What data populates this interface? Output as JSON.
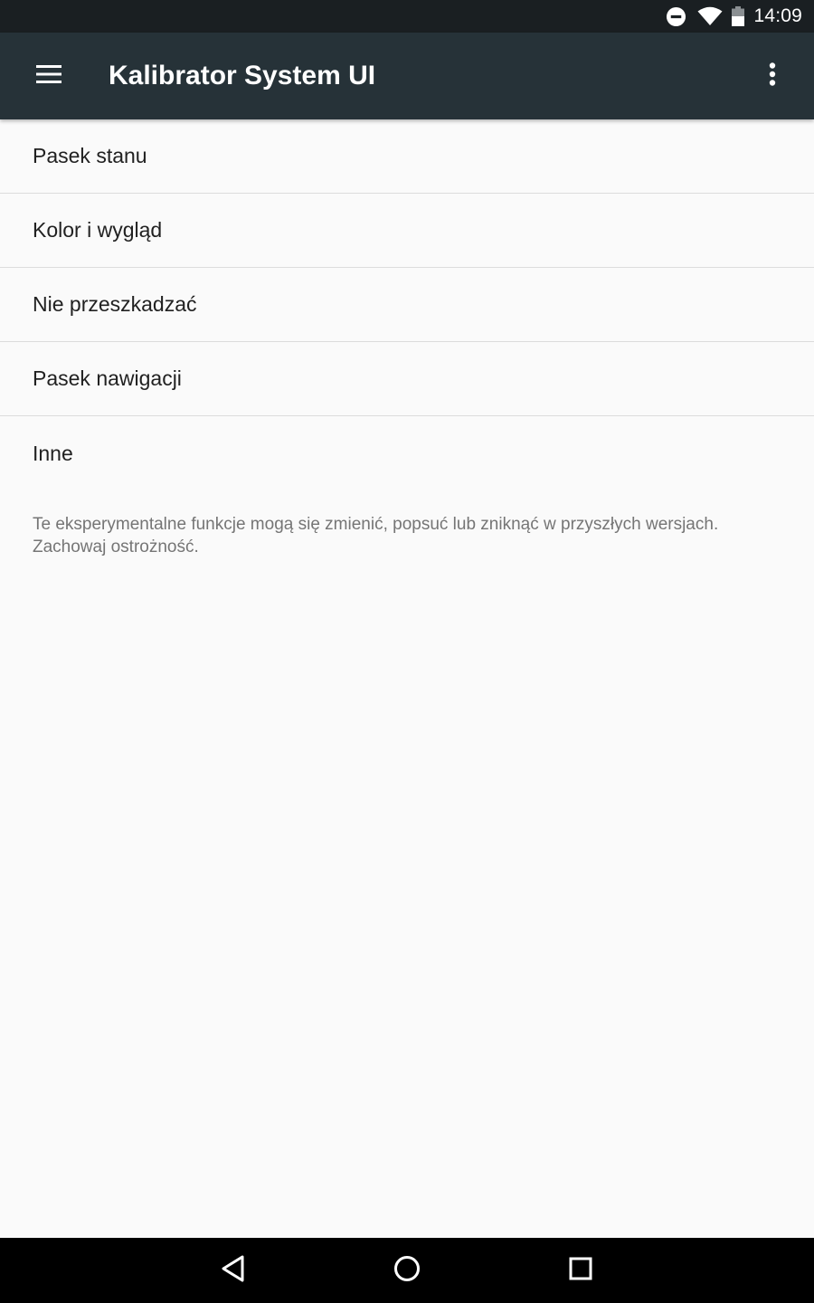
{
  "status_bar": {
    "time": "14:09",
    "icons": [
      "do-not-disturb-icon",
      "wifi-icon",
      "battery-icon"
    ]
  },
  "app_bar": {
    "title": "Kalibrator System UI",
    "navigation_icon": "menu-icon",
    "action_icon": "more-vert-icon",
    "background_color": "#263238"
  },
  "settings": {
    "items": [
      {
        "label": "Pasek stanu"
      },
      {
        "label": "Kolor i wygląd"
      },
      {
        "label": "Nie przeszkadzać"
      },
      {
        "label": "Pasek nawigacji"
      },
      {
        "label": "Inne"
      }
    ],
    "footer_note": "Te eksperymentalne funkcje mogą się zmienić, popsuć lub zniknąć w przyszłych wersjach. Zachowaj ostrożność."
  },
  "nav_bar": {
    "icons": [
      "back-icon",
      "home-icon",
      "recents-icon"
    ]
  }
}
